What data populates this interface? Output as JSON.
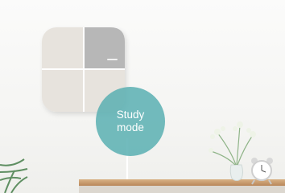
{
  "badge": {
    "line1": "Study",
    "line2": "mode"
  },
  "colors": {
    "badge_fill": "#5bb0b2",
    "wall": "#f6f6f4",
    "panel_light": "#e6e2dc",
    "panel_dark": "#b4b4b4",
    "shelf": "#c79a6c"
  }
}
